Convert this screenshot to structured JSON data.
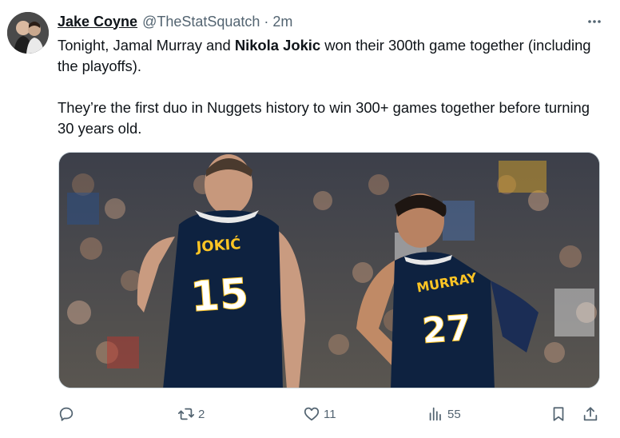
{
  "author": {
    "display_name": "Jake Coyne",
    "handle": "@TheStatSquatch",
    "separator": "·",
    "time": "2m"
  },
  "tweet": {
    "line1_a": "Tonight, Jamal Murray and ",
    "line1_bold": "Nikola Jokic",
    "line1_b": " won their 300th game together (including the playoffs).",
    "line2": "They’re the first duo in Nuggets history to win 300+ games together before turning 30 years old."
  },
  "media": {
    "jersey_left_name": "JOKIĆ",
    "jersey_left_number": "15",
    "jersey_right_name": "MURRAY",
    "jersey_right_number": "27"
  },
  "actions": {
    "reply": {
      "icon": "reply-icon",
      "count": ""
    },
    "retweet": {
      "icon": "retweet-icon",
      "count": "2"
    },
    "like": {
      "icon": "heart-icon",
      "count": "11"
    },
    "views": {
      "icon": "views-icon",
      "count": "55"
    },
    "bookmark": {
      "icon": "bookmark-icon"
    },
    "share": {
      "icon": "share-icon"
    }
  },
  "colors": {
    "text": "#0f1419",
    "secondary": "#536471",
    "jersey_navy": "#0e2240",
    "jersey_gold": "#fec524"
  }
}
